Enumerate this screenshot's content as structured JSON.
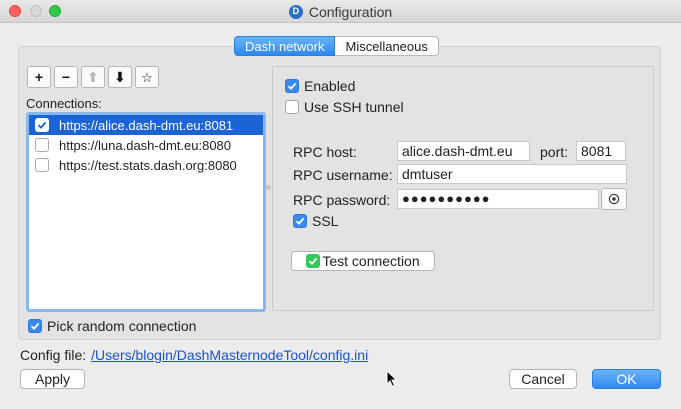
{
  "window": {
    "title": "Configuration"
  },
  "tabs": [
    {
      "label": "Dash network",
      "active": true
    },
    {
      "label": "Miscellaneous",
      "active": false
    }
  ],
  "toolbar": {
    "add": "+",
    "remove": "−",
    "move_up": "⬆",
    "move_down": "⬇",
    "favorite": "☆"
  },
  "connections": {
    "label": "Connections:",
    "items": [
      {
        "url": "https://alice.dash-dmt.eu:8081",
        "checked": true,
        "selected": true
      },
      {
        "url": "https://luna.dash-dmt.eu:8080",
        "checked": false,
        "selected": false
      },
      {
        "url": "https://test.stats.dash.org:8080",
        "checked": false,
        "selected": false
      }
    ],
    "pick_random_label": "Pick random connection",
    "pick_random_checked": true
  },
  "details": {
    "enabled_label": "Enabled",
    "enabled_checked": true,
    "ssh_label": "Use SSH tunnel",
    "ssh_checked": false,
    "rpc_host_label": "RPC host:",
    "rpc_host_value": "alice.dash-dmt.eu",
    "port_label": "port:",
    "port_value": "8081",
    "rpc_username_label": "RPC username:",
    "rpc_username_value": "dmtuser",
    "rpc_password_label": "RPC password:",
    "rpc_password_value": "●●●●●●●●●●",
    "ssl_label": "SSL",
    "ssl_checked": true,
    "test_connection_label": "Test connection"
  },
  "footer": {
    "config_label": "Config file:",
    "config_path": "/Users/blogin/DashMasternodeTool/config.ini",
    "apply_label": "Apply",
    "cancel_label": "Cancel",
    "ok_label": "OK"
  },
  "colors": {
    "accent": "#2d88f0",
    "selection": "#1c63d6",
    "link": "#1a4fd6",
    "success": "#34c759"
  }
}
